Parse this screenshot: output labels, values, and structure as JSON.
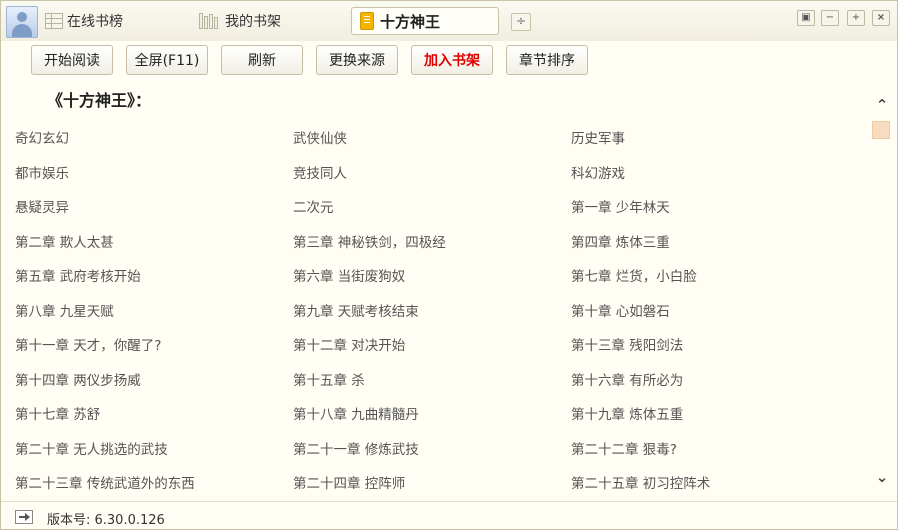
{
  "titlebar": {
    "tabs": [
      {
        "label": "在线书榜",
        "icon": "grid-icon"
      },
      {
        "label": "我的书架",
        "icon": "bookshelf-icon"
      }
    ],
    "active_tab": {
      "label": "十方神王",
      "icon": "book-icon"
    },
    "add_tab_symbol": "÷",
    "window_buttons": {
      "skin": "▣",
      "minimize": "−",
      "maximize": "+",
      "close": "×"
    }
  },
  "toolbar": {
    "start_reading": "开始阅读",
    "fullscreen": "全屏(F11)",
    "refresh": "刷新",
    "change_source": "更换来源",
    "add_to_shelf": "加入书架",
    "chapter_sort": "章节排序"
  },
  "content": {
    "book_title": "《十方神王》：",
    "chapters": [
      "奇幻玄幻",
      "武侠仙侠",
      "历史军事",
      "都市娱乐",
      "竞技同人",
      "科幻游戏",
      "悬疑灵异",
      "二次元",
      "第一章 少年林天",
      "第二章 欺人太甚",
      "第三章 神秘铁剑，四极经",
      "第四章 炼体三重",
      "第五章 武府考核开始",
      "第六章 当街废狗奴",
      "第七章 烂货，小白脸",
      "第八章 九星天赋",
      "第九章 天赋考核结束",
      "第十章 心如磐石",
      "第十一章 天才，你醒了?",
      "第十二章 对决开始",
      "第十三章 残阳剑法",
      "第十四章 两仪步扬威",
      "第十五章 杀",
      "第十六章 有所必为",
      "第十七章 苏舒",
      "第十八章 九曲精髓丹",
      "第十九章 炼体五重",
      "第二十章 无人挑选的武技",
      "第二十一章 修炼武技",
      "第二十二章 狠毒?",
      "第二十三章 传统武道外的东西",
      "第二十四章 控阵师",
      "第二十五章 初习控阵术"
    ]
  },
  "scrollbar": {
    "up_symbol": "⌃",
    "down_symbol": "⌄",
    "thumb_color": "#f7dcbf"
  },
  "status": {
    "version": "版本号: 6.30.0.126"
  },
  "colors": {
    "accent_red": "#e00000",
    "background": "#fffdf4"
  }
}
